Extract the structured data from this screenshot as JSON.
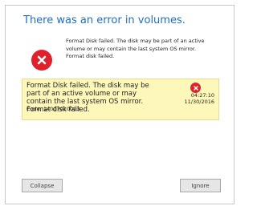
{
  "dialog": {
    "title": "There was an error in volumes.",
    "icon": "error-x-icon",
    "summary": {
      "message": "Format Disk failed. The disk may be part of an active volume or may contain the last system OS mirror.",
      "secondary": "Format disk failed."
    },
    "detail": {
      "message": "Format Disk failed. The disk may be part of an active volume or may contain the last system OS mirror.",
      "secondary": "Format disk failed.",
      "code": "Code: 14007010003",
      "time": "04:27:10",
      "date": "11/30/2016",
      "icon": "error-x-icon"
    },
    "buttons": {
      "collapse": "Collapse",
      "ignore": "Ignore"
    }
  },
  "colors": {
    "title": "#1e6ec4",
    "error": "#e0202a",
    "detail_background": "#fdf7b9",
    "button_background": "#e6e6e6"
  }
}
